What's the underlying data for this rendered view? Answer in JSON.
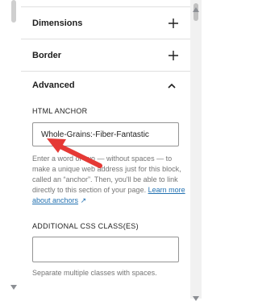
{
  "sections": {
    "dimensions": {
      "title": "Dimensions"
    },
    "border": {
      "title": "Border"
    },
    "advanced": {
      "title": "Advanced"
    }
  },
  "html_anchor": {
    "label": "HTML ANCHOR",
    "value": "Whole-Grains:-Fiber-Fantastic",
    "help_text": "Enter a word or two — without spaces — to make a unique web address just for this block, called an “anchor”. Then, you'll be able to link directly to this section of your page.",
    "help_link": "Learn more about anchors",
    "help_link_icon": "↗"
  },
  "css_classes": {
    "label": "ADDITIONAL CSS CLASS(ES)",
    "value": "",
    "help_text": "Separate multiple classes with spaces."
  },
  "colors": {
    "annotation_arrow": "#e53935",
    "link": "#2271b1"
  }
}
